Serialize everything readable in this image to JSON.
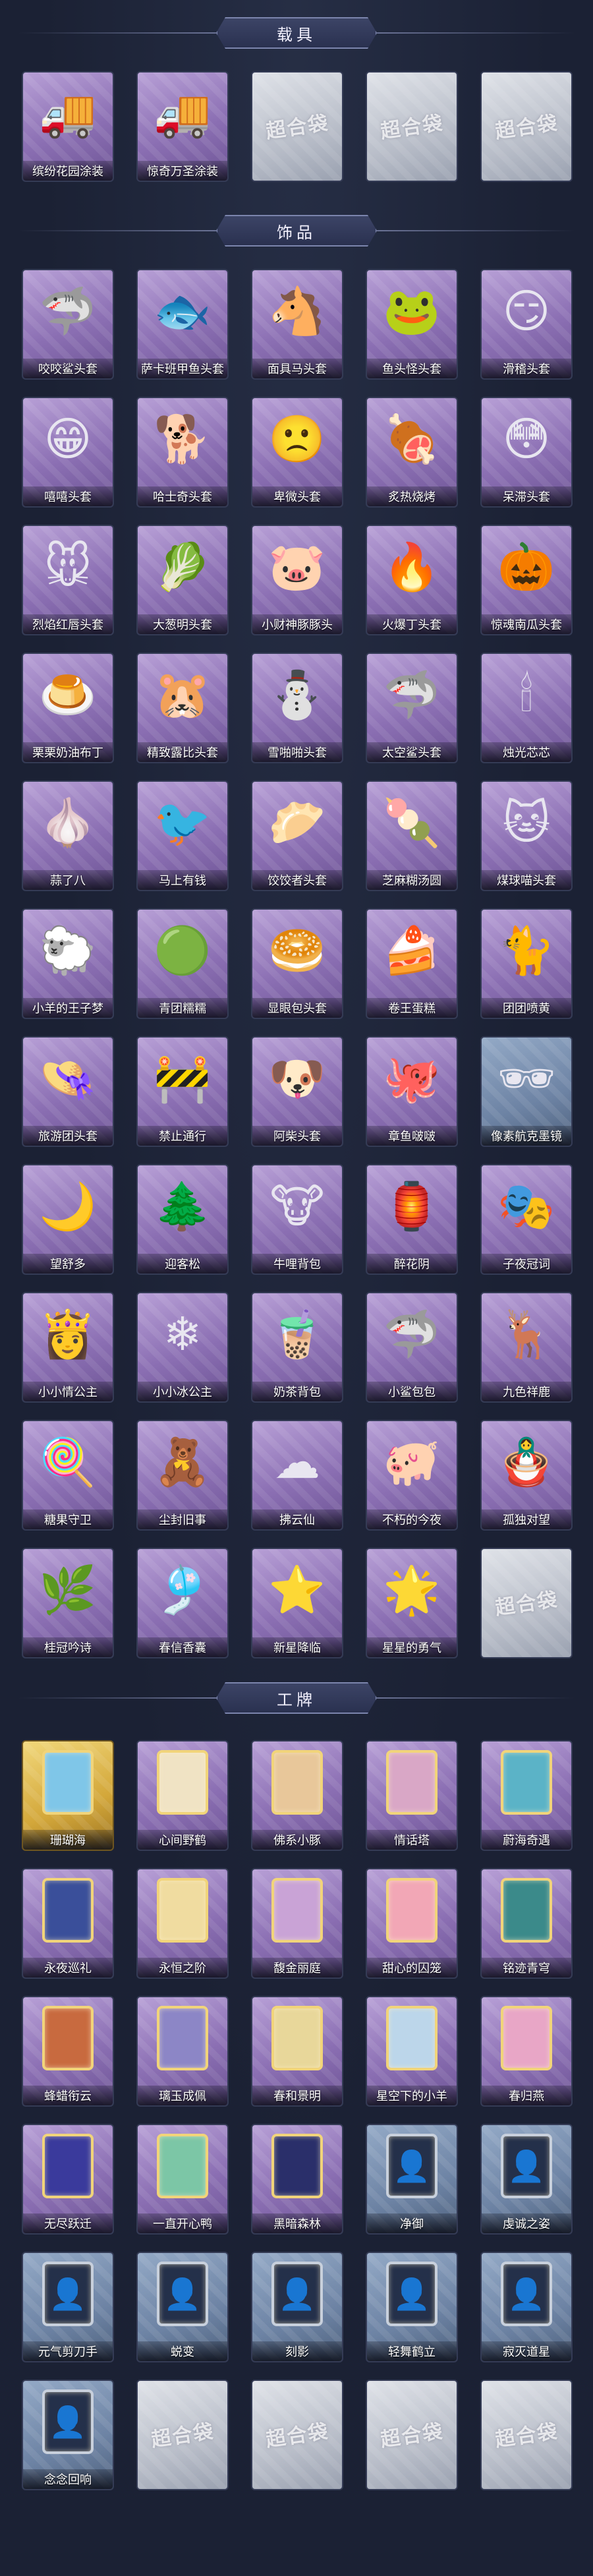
{
  "sections": [
    {
      "title": "载具",
      "items": [
        {
          "label": "缤纷花园涂装",
          "style": "purple",
          "icon": "ice-cream-truck-icon",
          "glyph": "🚚",
          "color": "#f2b8c6"
        },
        {
          "label": "惊奇万圣涂装",
          "style": "purple",
          "icon": "halloween-truck-icon",
          "glyph": "🚚",
          "color": "#8a3a3a"
        },
        {
          "label": "",
          "style": "empty",
          "watermark": "超合袋"
        },
        {
          "label": "",
          "style": "empty",
          "watermark": "超合袋"
        },
        {
          "label": "",
          "style": "empty",
          "watermark": "超合袋"
        }
      ]
    },
    {
      "title": "饰品",
      "items": [
        {
          "label": "咬咬鲨头套",
          "style": "purple",
          "icon": "shark-head-icon",
          "glyph": "🦈"
        },
        {
          "label": "萨卡班甲鱼头套",
          "style": "purple",
          "icon": "fish-head-icon",
          "glyph": "🐟"
        },
        {
          "label": "面具马头套",
          "style": "purple",
          "icon": "horse-head-icon",
          "glyph": "🐴"
        },
        {
          "label": "鱼头怪头套",
          "style": "purple",
          "icon": "green-fish-head-icon",
          "glyph": "🐸"
        },
        {
          "label": "滑稽头套",
          "style": "purple",
          "icon": "smirk-emoji-icon",
          "glyph": "😏"
        },
        {
          "label": "嘻嘻头套",
          "style": "purple",
          "icon": "grin-emoji-icon",
          "glyph": "😁"
        },
        {
          "label": "哈士奇头套",
          "style": "purple",
          "icon": "husky-head-icon",
          "glyph": "🐕"
        },
        {
          "label": "卑微头套",
          "style": "purple",
          "icon": "sad-emoji-icon",
          "glyph": "🙁"
        },
        {
          "label": "炙热烧烤",
          "style": "purple",
          "icon": "bbq-head-icon",
          "glyph": "🍖"
        },
        {
          "label": "呆滞头套",
          "style": "purple",
          "icon": "dazed-emoji-icon",
          "glyph": "😳"
        },
        {
          "label": "烈焰红唇头套",
          "style": "purple",
          "icon": "pikachu-head-icon",
          "glyph": "🐭"
        },
        {
          "label": "大葱明头套",
          "style": "purple",
          "icon": "scallion-head-icon",
          "glyph": "🥬"
        },
        {
          "label": "小财神豚豚头",
          "style": "purple",
          "icon": "lucky-pig-head-icon",
          "glyph": "🐷"
        },
        {
          "label": "火爆丁头套",
          "style": "purple",
          "icon": "fire-sprite-head-icon",
          "glyph": "🔥"
        },
        {
          "label": "惊魂南瓜头套",
          "style": "purple",
          "icon": "pumpkin-head-icon",
          "glyph": "🎃"
        },
        {
          "label": "栗栗奶油布丁",
          "style": "purple",
          "icon": "pudding-head-icon",
          "glyph": "🍮"
        },
        {
          "label": "精致露比头套",
          "style": "purple",
          "icon": "pink-beaver-head-icon",
          "glyph": "🐹"
        },
        {
          "label": "雪啪啪头套",
          "style": "purple",
          "icon": "snowman-head-icon",
          "glyph": "⛄"
        },
        {
          "label": "太空鲨头套",
          "style": "purple",
          "icon": "space-shark-head-icon",
          "glyph": "🦈"
        },
        {
          "label": "烛光芯芯",
          "style": "purple",
          "icon": "candle-head-icon",
          "glyph": "🕯"
        },
        {
          "label": "蒜了八",
          "style": "purple",
          "icon": "garlic-head-icon",
          "glyph": "🧄"
        },
        {
          "label": "马上有钱",
          "style": "purple",
          "icon": "money-bird-icon",
          "glyph": "🐦"
        },
        {
          "label": "饺饺者头套",
          "style": "purple",
          "icon": "dumpling-head-icon",
          "glyph": "🥟"
        },
        {
          "label": "芝麻糊汤圆",
          "style": "purple",
          "icon": "rice-ball-head-icon",
          "glyph": "🍡"
        },
        {
          "label": "煤球喵头套",
          "style": "purple",
          "icon": "black-cat-head-icon",
          "glyph": "🐱"
        },
        {
          "label": "小羊的王子梦",
          "style": "purple",
          "icon": "sheep-prince-head-icon",
          "glyph": "🐑"
        },
        {
          "label": "青团糯糯",
          "style": "purple",
          "icon": "green-dumpling-head-icon",
          "glyph": "🟢"
        },
        {
          "label": "显眼包头套",
          "style": "purple",
          "icon": "bun-head-icon",
          "glyph": "🥯"
        },
        {
          "label": "卷王蛋糕",
          "style": "purple",
          "icon": "cake-roll-head-icon",
          "glyph": "🍰"
        },
        {
          "label": "团团喷黄",
          "style": "purple",
          "icon": "yellow-cat-head-icon",
          "glyph": "🐈"
        },
        {
          "label": "旅游团头套",
          "style": "purple",
          "icon": "tourist-hat-head-icon",
          "glyph": "👒"
        },
        {
          "label": "禁止通行",
          "style": "purple",
          "icon": "traffic-cone-icon",
          "glyph": "🚧"
        },
        {
          "label": "阿柴头套",
          "style": "purple",
          "icon": "shiba-head-icon",
          "glyph": "🐶"
        },
        {
          "label": "章鱼啵啵",
          "style": "purple",
          "icon": "octopus-head-icon",
          "glyph": "🐙"
        },
        {
          "label": "像素航克墨镜",
          "style": "blue",
          "icon": "pixel-sunglasses-icon",
          "glyph": "🕶"
        },
        {
          "label": "望舒多",
          "style": "purple",
          "icon": "moon-pendant-icon",
          "glyph": "🌙"
        },
        {
          "label": "迎客松",
          "style": "purple",
          "icon": "pine-tree-pendant-icon",
          "glyph": "🌲"
        },
        {
          "label": "牛哩背包",
          "style": "purple",
          "icon": "cow-backpack-icon",
          "glyph": "🐮"
        },
        {
          "label": "醉花阴",
          "style": "purple",
          "icon": "lantern-pendant-icon",
          "glyph": "🏮"
        },
        {
          "label": "子夜冠词",
          "style": "purple",
          "icon": "opera-doll-pendant-icon",
          "glyph": "🎭"
        },
        {
          "label": "小小情公主",
          "style": "purple",
          "icon": "pink-princess-pendant-icon",
          "glyph": "👸"
        },
        {
          "label": "小小冰公主",
          "style": "purple",
          "icon": "ice-princess-pendant-icon",
          "glyph": "❄"
        },
        {
          "label": "奶茶背包",
          "style": "purple",
          "icon": "milk-tea-backpack-icon",
          "glyph": "🧋"
        },
        {
          "label": "小鲨包包",
          "style": "purple",
          "icon": "shark-bag-icon",
          "glyph": "🦈"
        },
        {
          "label": "九色祥鹿",
          "style": "purple",
          "icon": "deer-pendant-icon",
          "glyph": "🦌"
        },
        {
          "label": "糖果守卫",
          "style": "purple",
          "icon": "candy-guard-pendant-icon",
          "glyph": "🍭"
        },
        {
          "label": "尘封旧事",
          "style": "purple",
          "icon": "chibi-pendant-icon",
          "glyph": "🧸"
        },
        {
          "label": "拂云仙",
          "style": "purple",
          "icon": "cloud-pendant-icon",
          "glyph": "☁"
        },
        {
          "label": "不朽的今夜",
          "style": "purple",
          "icon": "pink-pig-pendant-icon",
          "glyph": "🐖"
        },
        {
          "label": "孤独对望",
          "style": "purple",
          "icon": "twin-doll-pendant-icon",
          "glyph": "🪆"
        },
        {
          "label": "桂冠吟诗",
          "style": "purple",
          "icon": "laurel-doll-pendant-icon",
          "glyph": "🌿"
        },
        {
          "label": "春信香囊",
          "style": "purple",
          "icon": "sachet-pendant-icon",
          "glyph": "🎐"
        },
        {
          "label": "新星降临",
          "style": "purple",
          "icon": "star-doll-pendant-icon",
          "glyph": "⭐"
        },
        {
          "label": "星星的勇气",
          "style": "purple",
          "icon": "star-courage-pendant-icon",
          "glyph": "🌟"
        },
        {
          "label": "",
          "style": "empty",
          "watermark": "超合袋"
        }
      ]
    },
    {
      "title": "工牌",
      "items": [
        {
          "label": "珊瑚海",
          "style": "gold",
          "icon": "coral-sea-card-icon",
          "frame": "gold",
          "fill": "#7fc6e8"
        },
        {
          "label": "心间野鹤",
          "style": "purple",
          "icon": "crane-card-icon",
          "frame": "gold",
          "fill": "#f0e3c4"
        },
        {
          "label": "佛系小豚",
          "style": "purple",
          "icon": "pig-card-icon",
          "frame": "gold",
          "fill": "#e8c79a"
        },
        {
          "label": "情话塔",
          "style": "purple",
          "icon": "tower-card-icon",
          "frame": "gold",
          "fill": "#d9a7c6"
        },
        {
          "label": "蔚海奇遇",
          "style": "purple",
          "icon": "ocean-card-icon",
          "frame": "gold",
          "fill": "#5bb3c7"
        },
        {
          "label": "永夜巡礼",
          "style": "purple",
          "icon": "night-card-icon",
          "frame": "gold",
          "fill": "#3a4f9a"
        },
        {
          "label": "永恒之阶",
          "style": "purple",
          "icon": "stairs-card-icon",
          "frame": "gold",
          "fill": "#f0dca0"
        },
        {
          "label": "馥金丽庭",
          "style": "purple",
          "icon": "gold-court-card-icon",
          "frame": "gold",
          "fill": "#c9a3d6"
        },
        {
          "label": "甜心的囚笼",
          "style": "purple",
          "icon": "sweet-cage-card-icon",
          "frame": "gold",
          "fill": "#f2a7b6"
        },
        {
          "label": "铭迹青穹",
          "style": "purple",
          "icon": "sky-card-icon",
          "frame": "gold",
          "fill": "#3b8a8a"
        },
        {
          "label": "蜂蜡衔云",
          "style": "purple",
          "icon": "honey-card-icon",
          "frame": "gold",
          "fill": "#c86a3f"
        },
        {
          "label": "璃玉成佩",
          "style": "purple",
          "icon": "jade-card-icon",
          "frame": "gold",
          "fill": "#8c86c6"
        },
        {
          "label": "春和景明",
          "style": "purple",
          "icon": "spring-card-icon",
          "frame": "gold",
          "fill": "#e8d79a"
        },
        {
          "label": "星空下的小羊",
          "style": "purple",
          "icon": "starry-sheep-card-icon",
          "frame": "gold",
          "fill": "#bcd6ea"
        },
        {
          "label": "春归燕",
          "style": "purple",
          "icon": "swallow-card-icon",
          "frame": "gold",
          "fill": "#e8a6c6"
        },
        {
          "label": "无尽跃迁",
          "style": "purple",
          "icon": "warp-card-icon",
          "frame": "gold",
          "fill": "#3a3a9c"
        },
        {
          "label": "一直开心鸭",
          "style": "purple",
          "icon": "duck-card-icon",
          "frame": "gold",
          "fill": "#7cc6a6"
        },
        {
          "label": "黑暗森林",
          "style": "purple",
          "icon": "dark-forest-card-icon",
          "frame": "gold",
          "fill": "#2a2f6a"
        },
        {
          "label": "净御",
          "style": "blue",
          "icon": "silhouette-card-icon",
          "frame": "silhouette"
        },
        {
          "label": "虔诚之姿",
          "style": "blue",
          "icon": "silhouette-card-icon",
          "frame": "silhouette"
        },
        {
          "label": "元气剪刀手",
          "style": "blue",
          "icon": "silhouette-card-icon",
          "frame": "silhouette"
        },
        {
          "label": "蜕变",
          "style": "blue",
          "icon": "silhouette-card-icon",
          "frame": "silhouette"
        },
        {
          "label": "刻影",
          "style": "blue",
          "icon": "silhouette-card-icon",
          "frame": "silhouette"
        },
        {
          "label": "轻舞鹤立",
          "style": "blue",
          "icon": "silhouette-card-icon",
          "frame": "silhouette"
        },
        {
          "label": "寂灭道星",
          "style": "blue",
          "icon": "silhouette-card-icon",
          "frame": "silhouette"
        },
        {
          "label": "念念回响",
          "style": "blue",
          "icon": "silhouette-card-icon",
          "frame": "silhouette"
        },
        {
          "label": "",
          "style": "empty",
          "watermark": "超合袋"
        },
        {
          "label": "",
          "style": "empty",
          "watermark": "超合袋"
        },
        {
          "label": "",
          "style": "empty",
          "watermark": "超合袋"
        },
        {
          "label": "",
          "style": "empty",
          "watermark": "超合袋"
        }
      ]
    }
  ]
}
